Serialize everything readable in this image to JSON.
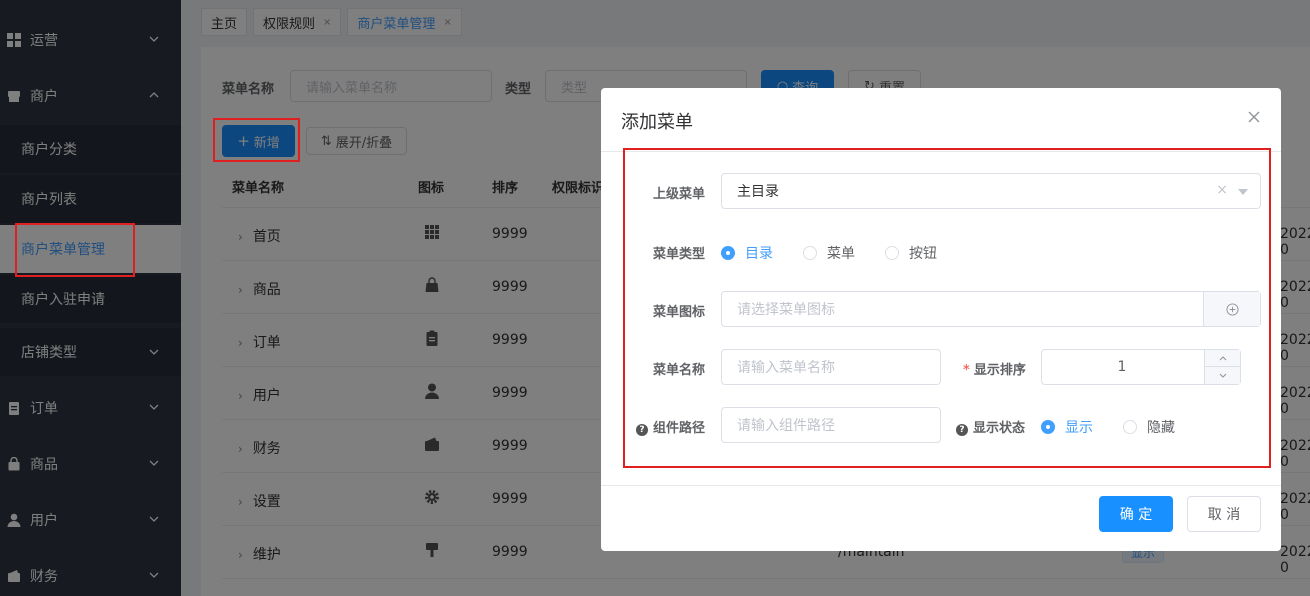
{
  "sidebar": {
    "items": [
      {
        "label": "运营",
        "icon": "grid-icon"
      },
      {
        "label": "商户",
        "icon": "store-icon"
      },
      {
        "label": "订单",
        "icon": "clipboard-icon"
      },
      {
        "label": "商品",
        "icon": "bag-icon"
      },
      {
        "label": "用户",
        "icon": "user-icon"
      },
      {
        "label": "财务",
        "icon": "wallet-icon"
      }
    ],
    "sub_items": [
      {
        "label": "商户分类"
      },
      {
        "label": "商户列表"
      },
      {
        "label": "商户菜单管理"
      },
      {
        "label": "商户入驻申请"
      },
      {
        "label": "店铺类型"
      }
    ]
  },
  "tabs": [
    {
      "label": "主页"
    },
    {
      "label": "权限规则"
    },
    {
      "label": "商户菜单管理"
    }
  ],
  "tab_close": "×",
  "search": {
    "name_label": "菜单名称",
    "name_placeholder": "请输入菜单名称",
    "type_label": "类型",
    "type_placeholder": "类型",
    "query_button": "查询",
    "reset_button": "重置"
  },
  "toolbar": {
    "add_button": "新增",
    "expand_button": "展开/折叠"
  },
  "table": {
    "headers": [
      "菜单名称",
      "图标",
      "排序",
      "权限标识"
    ],
    "rows": [
      {
        "name": "首页",
        "icon": "grid-icon",
        "sort": "9999",
        "date": "2022-0"
      },
      {
        "name": "商品",
        "icon": "bag-icon",
        "sort": "9999",
        "date": "2022-0"
      },
      {
        "name": "订单",
        "icon": "clipboard-icon",
        "sort": "9999",
        "date": "2022-0"
      },
      {
        "name": "用户",
        "icon": "user-icon",
        "sort": "9999",
        "date": "2022-0"
      },
      {
        "name": "财务",
        "icon": "wallet-icon",
        "sort": "9999",
        "date": "2022-0"
      },
      {
        "name": "设置",
        "icon": "gear-icon",
        "sort": "9999",
        "date": "2022-0"
      },
      {
        "name": "维护",
        "icon": "brush-icon",
        "sort": "9999",
        "date": "2022-0"
      }
    ],
    "partial_path": "/maintain",
    "partial_badge": "显示"
  },
  "dialog": {
    "title": "添加菜单",
    "parent_label": "上级菜单",
    "parent_value": "主目录",
    "type_label": "菜单类型",
    "type_options": [
      "目录",
      "菜单",
      "按钮"
    ],
    "type_selected": 0,
    "icon_label": "菜单图标",
    "icon_placeholder": "请选择菜单图标",
    "name_label": "菜单名称",
    "name_placeholder": "请输入菜单名称",
    "sort_label": "显示排序",
    "sort_required": "*",
    "sort_value": "1",
    "component_label": "组件路径",
    "component_placeholder": "请输入组件路径",
    "status_label": "显示状态",
    "status_options": [
      "显示",
      "隐藏"
    ],
    "status_selected": 0,
    "confirm_button": "确 定",
    "cancel_button": "取 消"
  },
  "colors": {
    "sidebar_bg": "#2e3543",
    "accent": "#409eff",
    "primary_button": "#1890ff",
    "highlight_border": "#e02020"
  }
}
